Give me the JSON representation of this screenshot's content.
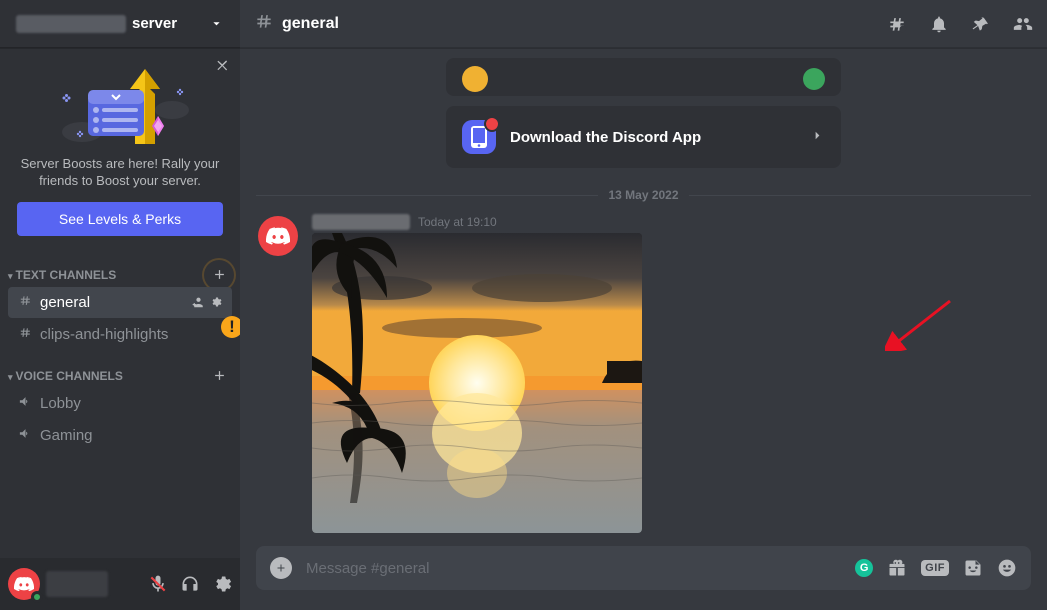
{
  "server_header": {
    "suffix": "server"
  },
  "boost": {
    "text": "Server Boosts are here! Rally your friends to Boost your server.",
    "button": "See Levels & Perks"
  },
  "sections": {
    "text_channels_label": "TEXT CHANNELS",
    "voice_channels_label": "VOICE CHANNELS"
  },
  "text_channels": [
    {
      "name": "general"
    },
    {
      "name": "clips-and-highlights"
    }
  ],
  "voice_channels": [
    {
      "name": "Lobby"
    },
    {
      "name": "Gaming"
    }
  ],
  "channel_header": {
    "name": "general"
  },
  "welcome": {
    "download_label": "Download the Discord App"
  },
  "divider_date": "13 May 2022",
  "message": {
    "timestamp": "Today at 19:10"
  },
  "composer": {
    "placeholder": "Message #general",
    "gif_label": "GIF"
  },
  "orange_badge_glyph": "!"
}
